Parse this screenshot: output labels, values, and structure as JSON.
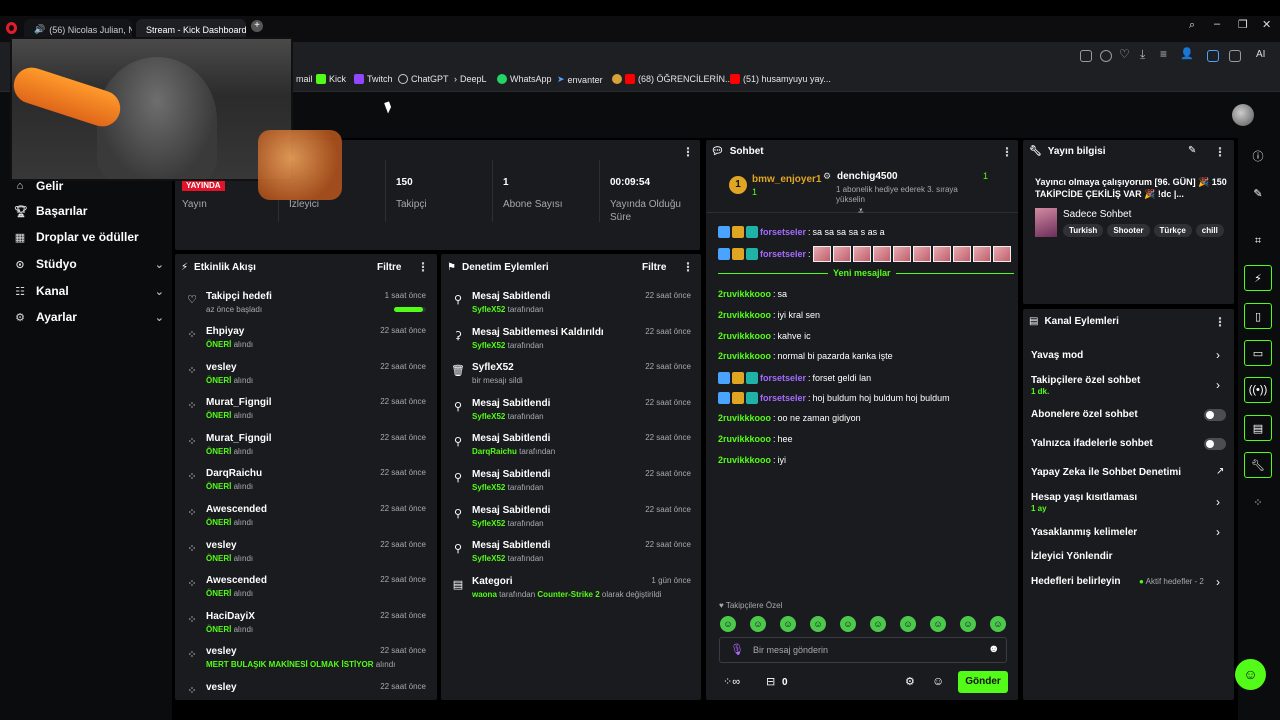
{
  "browser": {
    "tabs": [
      {
        "label": "(56) Nicolas Julian, Ni"
      },
      {
        "label": "Stream - Kick Dashboard"
      }
    ],
    "bookmarks": [
      {
        "label": "mail"
      },
      {
        "label": "Kick"
      },
      {
        "label": "Twitch"
      },
      {
        "label": "ChatGPT"
      },
      {
        "label": "DeepL"
      },
      {
        "label": "WhatsApp"
      },
      {
        "label": "envanter"
      },
      {
        "label": "(68) ÖĞRENCİLERİN..."
      },
      {
        "label": "(51) husamyuyu yay..."
      }
    ],
    "ai_label": "AI"
  },
  "sidebar": {
    "items": [
      {
        "label": "Gelir",
        "icon": "home-icon"
      },
      {
        "label": "Başarılar",
        "icon": "trophy-icon"
      },
      {
        "label": "Droplar ve ödüller",
        "icon": "gift-icon"
      },
      {
        "label": "Stüdyo",
        "icon": "studio-icon"
      },
      {
        "label": "Kanal",
        "icon": "channel-icon"
      },
      {
        "label": "Ayarlar",
        "icon": "gear-icon"
      }
    ]
  },
  "stats": {
    "live_badge": "YAYINDA",
    "stream_label": "Yayın",
    "viewers_label": "İzleyici",
    "followers_value": "150",
    "followers_label": "Takipçi",
    "subs_value": "1",
    "subs_label": "Abone Sayısı",
    "uptime_value": "00:09:54",
    "uptime_label": "Yayında Olduğu Süre"
  },
  "activity": {
    "title": "Etkinlik Akışı",
    "filter": "Filtre",
    "goal_title": "Takipçi hedefi",
    "goal_sub": "az önce başladı",
    "goal_time": "1 saat önce",
    "goal_progress": 0.9,
    "rows": [
      {
        "name": "Ehpiyay",
        "tag": "ÖNERİ",
        "suffix": "alındı",
        "time": "22 saat önce"
      },
      {
        "name": "vesley",
        "tag": "ÖNERİ",
        "suffix": "alındı",
        "time": "22 saat önce"
      },
      {
        "name": "Murat_Figngil",
        "tag": "ÖNERİ",
        "suffix": "alındı",
        "time": "22 saat önce"
      },
      {
        "name": "Murat_Figngil",
        "tag": "ÖNERİ",
        "suffix": "alındı",
        "time": "22 saat önce"
      },
      {
        "name": "DarqRaichu",
        "tag": "ÖNERİ",
        "suffix": "alındı",
        "time": "22 saat önce"
      },
      {
        "name": "Awescended",
        "tag": "ÖNERİ",
        "suffix": "alındı",
        "time": "22 saat önce"
      },
      {
        "name": "vesley",
        "tag": "ÖNERİ",
        "suffix": "alındı",
        "time": "22 saat önce"
      },
      {
        "name": "Awescended",
        "tag": "ÖNERİ",
        "suffix": "alındı",
        "time": "22 saat önce"
      },
      {
        "name": "HaciDayiX",
        "tag": "ÖNERİ",
        "suffix": "alındı",
        "time": "22 saat önce"
      },
      {
        "name": "vesley",
        "tag": "MERT BULAŞIK MAKİNESİ OLMAK İSTİYOR",
        "suffix": "alındı",
        "time": "22 saat önce"
      },
      {
        "name": "vesley",
        "tag": "",
        "suffix": "",
        "time": "22 saat önce"
      }
    ]
  },
  "moderation": {
    "title": "Denetim Eylemleri",
    "filter": "Filtre",
    "rows": [
      {
        "title": "Mesaj Sabitlendi",
        "user": "SyfleX52",
        "suffix": "tarafından",
        "time": "22 saat önce",
        "icon": "pin-icon"
      },
      {
        "title": "Mesaj Sabitlemesi Kaldırıldı",
        "user": "SyfleX52",
        "suffix": "tarafından",
        "time": "22 saat önce",
        "icon": "unpin-icon"
      },
      {
        "title": "SyfleX52",
        "user": "",
        "suffix": "bir mesajı sildi",
        "time": "22 saat önce",
        "icon": "trash-icon"
      },
      {
        "title": "Mesaj Sabitlendi",
        "user": "SyfleX52",
        "suffix": "tarafından",
        "time": "22 saat önce",
        "icon": "pin-icon"
      },
      {
        "title": "Mesaj Sabitlendi",
        "user": "DarqRaichu",
        "suffix": "tarafından",
        "time": "22 saat önce",
        "icon": "pin-icon"
      },
      {
        "title": "Mesaj Sabitlendi",
        "user": "SyfleX52",
        "suffix": "tarafından",
        "time": "22 saat önce",
        "icon": "pin-icon"
      },
      {
        "title": "Mesaj Sabitlendi",
        "user": "SyfleX52",
        "suffix": "tarafından",
        "time": "22 saat önce",
        "icon": "pin-icon"
      },
      {
        "title": "Mesaj Sabitlendi",
        "user": "SyfleX52",
        "suffix": "tarafından",
        "time": "22 saat önce",
        "icon": "pin-icon"
      }
    ],
    "category_title": "Kategori",
    "category_user": "waona",
    "category_mid": "tarafından",
    "category_value": "Counter-Strike 2",
    "category_suffix": "olarak değiştirildi",
    "category_time": "1 gün önce"
  },
  "chat": {
    "title": "Sohbet",
    "top_gifter": "bmw_enjoyer1",
    "top_gifter_count": "1",
    "top_gifter_rank": "1",
    "gifter2": "denchig4500",
    "gifter2_count": "1",
    "gifter2_note": "1 abonelik hediye ederek 3. sıraya yükselin",
    "new_messages": "Yeni mesajlar",
    "messages": [
      {
        "user": "forsetseler",
        "text": "sa sa sa sa s as a",
        "color": "#a26bff",
        "badges": true
      },
      {
        "user": "forsetseler",
        "text": "",
        "color": "#a26bff",
        "badges": true,
        "emotes": 10
      },
      {
        "user": "2ruvikkkooo",
        "text": "sa",
        "color": "#53fc18",
        "badges": false
      },
      {
        "user": "2ruvikkkooo",
        "text": "iyi kral sen",
        "color": "#53fc18",
        "badges": false
      },
      {
        "user": "2ruvikkkooo",
        "text": "kahve ic",
        "color": "#53fc18",
        "badges": false
      },
      {
        "user": "2ruvikkkooo",
        "text": "normal bi pazarda kanka işte",
        "color": "#53fc18",
        "badges": false
      },
      {
        "user": "forsetseler",
        "text": "forset geldi lan",
        "color": "#a26bff",
        "badges": true
      },
      {
        "user": "forsetseler",
        "text": "hoj buldum hoj buldum hoj buldum",
        "color": "#a26bff",
        "badges": true
      },
      {
        "user": "2ruvikkkooo",
        "text": "oo ne zaman gidiyon",
        "color": "#53fc18",
        "badges": false
      },
      {
        "user": "2ruvikkkooo",
        "text": "hee",
        "color": "#53fc18",
        "badges": false
      },
      {
        "user": "2ruvikkkooo",
        "text": "iyi",
        "color": "#53fc18",
        "badges": false
      }
    ],
    "followers_only": "Takipçilere Özel",
    "input_placeholder": "Bir mesaj gönderin",
    "points": "0",
    "send": "Gönder"
  },
  "stream_info": {
    "title": "Yayın bilgisi",
    "stream_title": "Yayıncı olmaya çalışıyorum [96. GÜN] 🎉 150 TAKİPCİDE ÇEKİLİŞ VAR 🎉 !dc |...",
    "category": "Sadece Sohbet",
    "tags": [
      "Turkish",
      "Shooter",
      "Türkçe",
      "chill"
    ]
  },
  "channel_actions": {
    "title": "Kanal Eylemleri",
    "slow_mode": "Yavaş mod",
    "followers_chat": "Takipçilere özel sohbet",
    "followers_chat_sub": "1 dk.",
    "subs_chat": "Abonelere özel sohbet",
    "emotes_chat": "Yalnızca ifadelerle sohbet",
    "ai_moderation": "Yapay Zeka ile Sohbet Denetimi",
    "account_age": "Hesap yaşı kısıtlaması",
    "account_age_sub": "1 ay",
    "banned_words": "Yasaklanmış kelimeler",
    "raid": "İzleyici Yönlendir",
    "goals": "Hedefleri belirleyin",
    "goals_status": "Aktif hedefler - 2"
  },
  "colors": {
    "accent": "#53fc18",
    "panel": "#1a1b1e",
    "background": "#0b0c0d",
    "live": "#e3132b"
  }
}
